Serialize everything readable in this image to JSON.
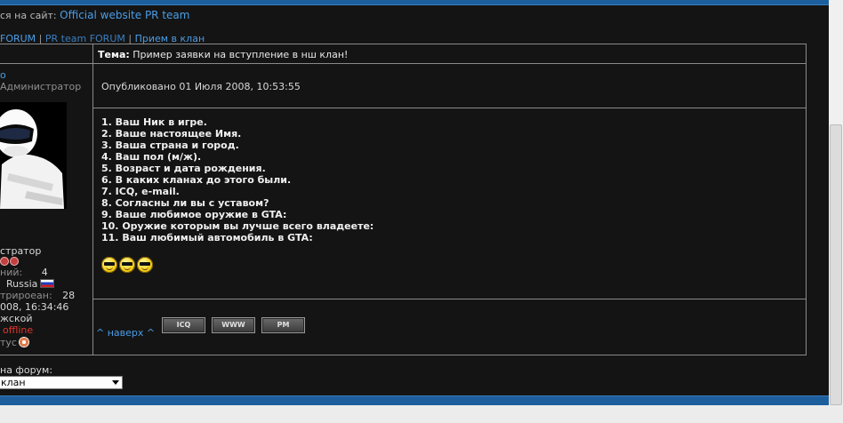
{
  "header": {
    "prefix_text": "ся на сайт:",
    "site_link": "Official website PR team"
  },
  "breadcrumb": {
    "item1": "FORUM",
    "sep1": "|",
    "item2": "PR team FORUM",
    "sep2": "|",
    "item3": "Прием в клан"
  },
  "post": {
    "subject_label": "Тема:",
    "subject_text": "Пример заявки на вступление в нш клан!",
    "published": "Опубликовано 01 Июля 2008, 10:53:55",
    "lines": [
      "1. Ваш Ник в игре.",
      "2. Ваше настоящее Имя.",
      "3. Ваша страна и город.",
      "4. Ваш пол (м/ж).",
      "5. Возраст и дата рождения.",
      "6. В каких кланах до этого были.",
      "7. ICQ, e-mail.",
      "8. Согласны ли вы с уставом?",
      "9. Ваше любимое оружие в GTA:",
      "10. Оружие которым вы лучше всего владеете:",
      "11. Ваш любимый автомобиль в GTA:"
    ],
    "smiley_icon": "cool-smiley-icon",
    "top_link": "^ наверх ^",
    "buttons": {
      "icq": "ICQ",
      "www": "WWW",
      "pm": "PM"
    }
  },
  "author": {
    "name": "о",
    "role": "Администратор",
    "rank": "стратор",
    "posts_label": "ний:",
    "posts_value": "4",
    "country": "Russia",
    "registered_label": "трироеан:",
    "registered_value": "28",
    "registered_date": "008, 16:34:46",
    "gender": "жской",
    "online_status": "offline",
    "status_label": "тус"
  },
  "jump": {
    "label": "на форум:",
    "selected": "клан"
  },
  "colors": {
    "link": "#4a9de6",
    "offline": "#e0362c",
    "bar": "#1d5e9c"
  }
}
